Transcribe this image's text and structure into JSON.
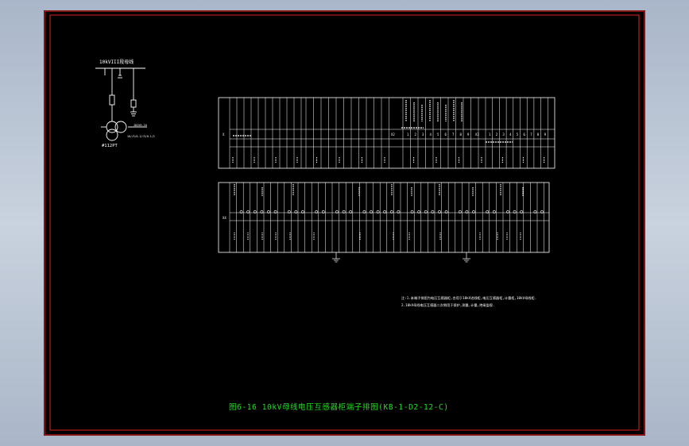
{
  "colors": {
    "background": "#000000",
    "frame": "#e02020",
    "line": "#ffffff",
    "title": "#22dd22",
    "outer": "#b8c3d3"
  },
  "diagram": {
    "bus_label": "10kVIII段母线",
    "pt_label": "#112PT",
    "pt_spec_top": "JDZX9-10",
    "pt_spec_bottom": "10/√3/0.1/√3/0.1/3",
    "table1_left_label": "X",
    "table1_mid_label": "X2",
    "table1_right_label": "X3",
    "table2_left_label": "X4",
    "table1_mid_numbers": [
      "1",
      "2",
      "3",
      "4",
      "5",
      "6",
      "7",
      "8",
      "9"
    ],
    "table1_right_numbers": [
      "1",
      "2",
      "3",
      "4",
      "5",
      "6",
      "7",
      "8",
      "9"
    ],
    "notes": [
      "注:1.本端子排图为电压互感器柜,合用于10kV进线柜,电压互感器柜,计量柜,10kV母线柜.",
      "   2.10kV母线电压互感器二次侧用于保护,测量,计量,绝缘监视."
    ]
  },
  "title": "图6-16 10kV母线电压互感器柜端子排图(KB-1-D2-12-C)"
}
